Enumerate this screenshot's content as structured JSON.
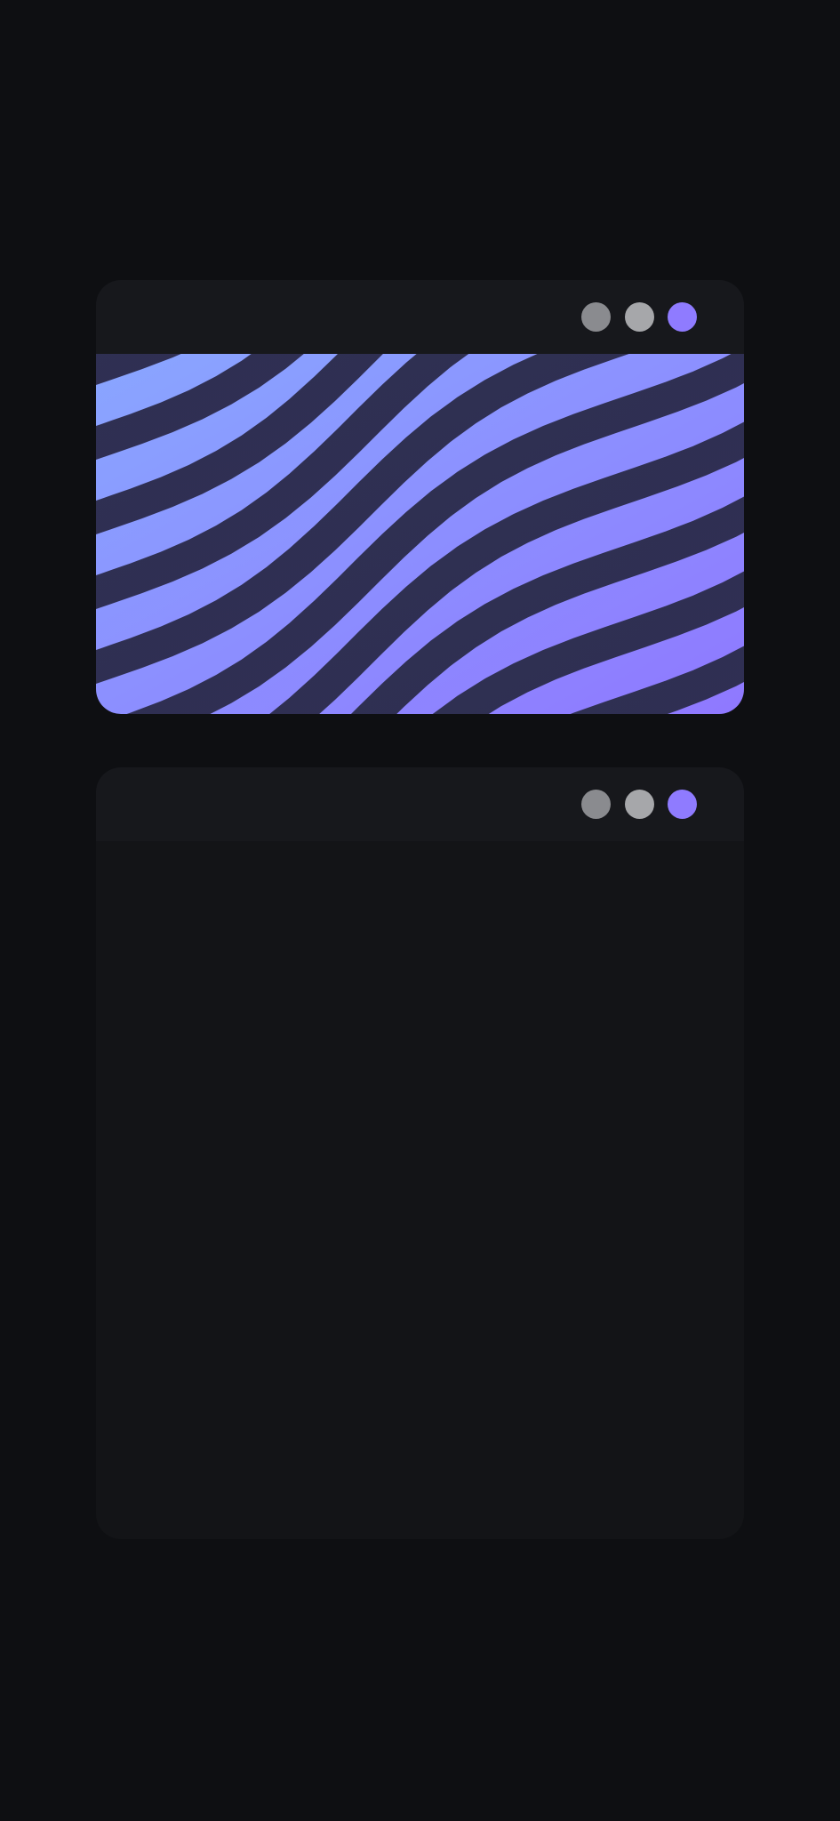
{
  "windows": [
    {
      "id": "pattern-window",
      "controls": [
        {
          "name": "window-control-1",
          "color": "#8a8b8f"
        },
        {
          "name": "window-control-2",
          "color": "#a6a7aa"
        },
        {
          "name": "window-control-3",
          "color": "#8f7bff"
        }
      ],
      "content": {
        "type": "wave-pattern",
        "colors": {
          "stripe_light_start": "#89a6ff",
          "stripe_light_end": "#8f78ff",
          "stripe_dark_start": "#2b3550",
          "stripe_dark_end": "#332a55"
        }
      }
    },
    {
      "id": "empty-window",
      "controls": [
        {
          "name": "window-control-1",
          "color": "#8a8b8f"
        },
        {
          "name": "window-control-2",
          "color": "#a6a7aa"
        },
        {
          "name": "window-control-3",
          "color": "#8f7bff"
        }
      ],
      "content": {
        "type": "empty"
      }
    }
  ]
}
